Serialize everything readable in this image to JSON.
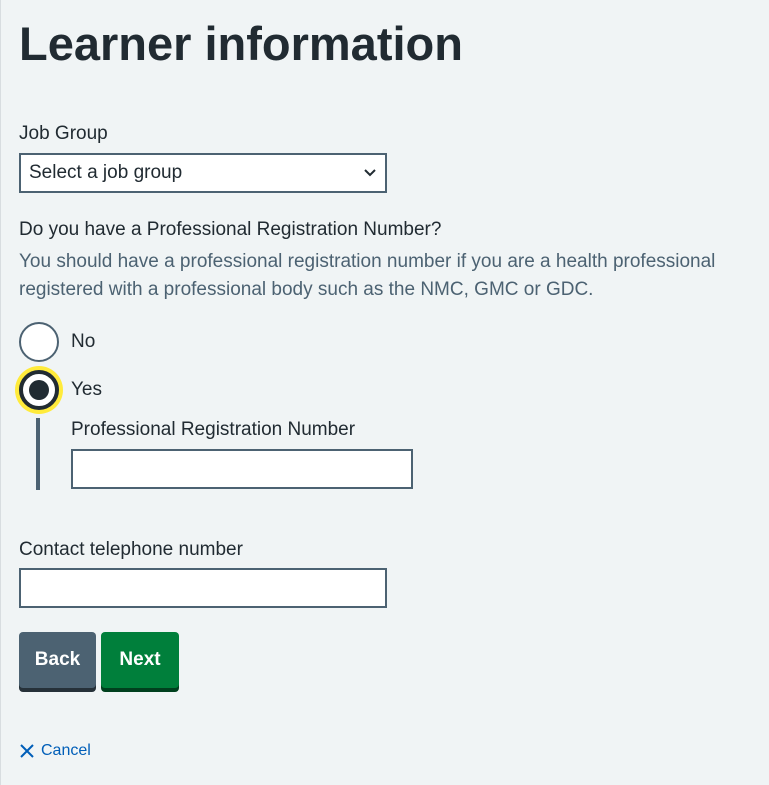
{
  "page": {
    "title": "Learner information"
  },
  "job_group": {
    "label": "Job Group",
    "selected": "Select a job group"
  },
  "registration": {
    "question": "Do you have a Professional Registration Number?",
    "hint": "You should have a professional registration number if you are a health professional registered with a professional body such as the NMC, GMC or GDC.",
    "options": [
      {
        "label": "No",
        "checked": false
      },
      {
        "label": "Yes",
        "checked": true
      }
    ],
    "number_label": "Professional Registration Number",
    "number_value": ""
  },
  "telephone": {
    "label": "Contact telephone number",
    "value": ""
  },
  "actions": {
    "back_label": "Back",
    "next_label": "Next",
    "cancel_label": "Cancel"
  },
  "colors": {
    "background": "#f0f4f5",
    "text": "#212b32",
    "secondary_text": "#4c6272",
    "back_button": "#4c6272",
    "next_button": "#007f3b",
    "link": "#005eb8",
    "focus": "#ffeb3b"
  }
}
